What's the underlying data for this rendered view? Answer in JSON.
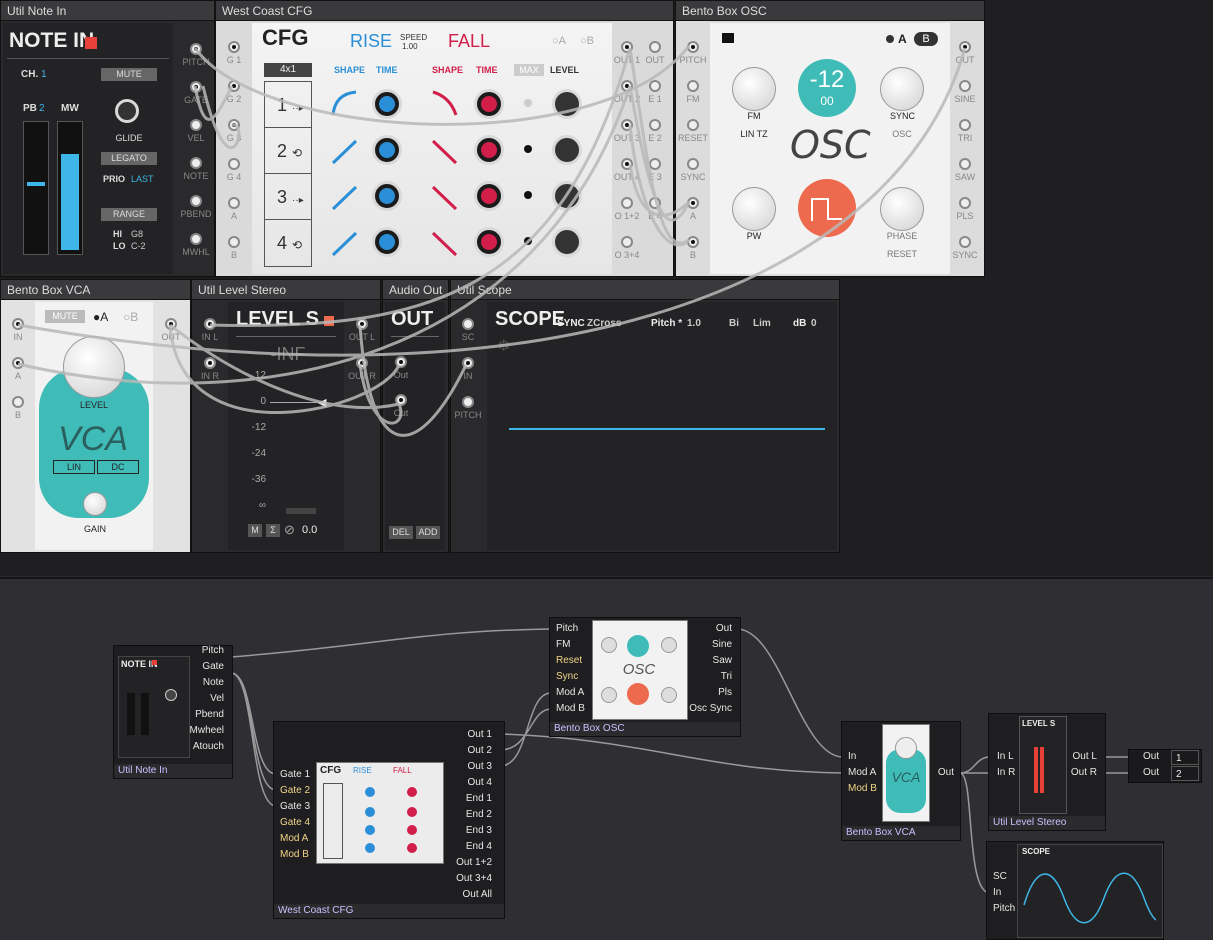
{
  "rack": {
    "note_in": {
      "title": "Util Note In",
      "heading": "NOTE IN",
      "ch_label": "CH.",
      "ch_value": "1",
      "mute": "MUTE",
      "pb_label": "PB",
      "pb_value": "2",
      "mw_label": "MW",
      "glide": "GLIDE",
      "legato": "LEGATO",
      "prio_label": "PRIO",
      "prio_value": "LAST",
      "range": "RANGE",
      "hi_label": "HI",
      "hi_value": "G8",
      "lo_label": "LO",
      "lo_value": "C-2",
      "jacks": [
        "PITCH",
        "GATE",
        "VEL",
        "NOTE",
        "PBEND",
        "MWHL"
      ]
    },
    "cfg": {
      "title": "West Coast CFG",
      "heading": "CFG",
      "rise": "RISE",
      "speed_label": "SPEED",
      "speed_value": "1.00",
      "fall": "FALL",
      "a": "A",
      "b": "B",
      "mode": "4x1",
      "shape": "SHAPE",
      "time": "TIME",
      "shape2": "SHAPE",
      "time2": "TIME",
      "max": "MAX",
      "level": "LEVEL",
      "rows": [
        "1",
        "2",
        "3",
        "4"
      ],
      "in_jacks": [
        "G 1",
        "G 2",
        "G 3",
        "G 4",
        "A",
        "B"
      ],
      "out_left": [
        "OUT 1",
        "OUT 2",
        "OUT 3",
        "OUT 4",
        "O 1+2",
        "O 3+4"
      ],
      "out_right": [
        "OUT",
        "E 1",
        "E 2",
        "E 3",
        "E 4"
      ]
    },
    "osc": {
      "title": "Bento Box OSC",
      "a": "A",
      "b": "B",
      "fm": "FM",
      "lin_tz": "LIN TZ",
      "display_top": "-12",
      "display_bottom": "00",
      "sync": "SYNC",
      "osc_small": "OSC",
      "osc_big": "OSC",
      "pw": "PW",
      "phase": "PHASE",
      "reset": "RESET",
      "in_jacks": [
        "PITCH",
        "FM",
        "RESET",
        "SYNC",
        "A",
        "B"
      ],
      "out_jacks": [
        "OUT",
        "SINE",
        "TRI",
        "SAW",
        "PLS",
        "SYNC"
      ]
    },
    "vca": {
      "title": "Bento Box VCA",
      "mute": "MUTE",
      "a": "A",
      "b": "B",
      "level": "LEVEL",
      "vca": "VCA",
      "lin": "LIN",
      "dc": "DC",
      "gain": "GAIN",
      "in_jacks": [
        "IN",
        "A",
        "B"
      ],
      "out_jack": "OUT"
    },
    "level_stereo": {
      "title": "Util Level Stereo",
      "heading": "LEVEL S",
      "readout": "-INF",
      "scale": [
        "12",
        "0",
        "-12",
        "-24",
        "-36",
        "∞"
      ],
      "m": "M",
      "sigma": "Σ",
      "value": "0.0",
      "in_jacks": [
        "IN L",
        "IN R"
      ],
      "out_jacks": [
        "OUT L",
        "OUT R"
      ]
    },
    "audio_out": {
      "title": "Audio Out",
      "heading": "OUT",
      "jacks": [
        "Out",
        "Out"
      ],
      "del": "DEL",
      "add": "ADD"
    },
    "scope": {
      "title": "Util Scope",
      "heading": "SCOPE",
      "sync_label": "SYNC",
      "sync_value": "ZCross",
      "pitch_label": "Pitch *",
      "pitch_value": "1.0",
      "bi": "Bi",
      "lim": "Lim",
      "db_label": "dB",
      "db_value": "0",
      "jacks": [
        "SC",
        "IN",
        "PITCH"
      ]
    }
  },
  "graph": {
    "note_in": {
      "name": "Util Note In",
      "outputs": [
        "Pitch",
        "Gate",
        "Note",
        "Vel",
        "Pbend",
        "Mwheel",
        "Atouch"
      ]
    },
    "cfg": {
      "name": "West Coast CFG",
      "inputs": [
        "Gate 1",
        "Gate 2",
        "Gate 3",
        "Gate 4",
        "Mod A",
        "Mod B"
      ],
      "outputs": [
        "Out 1",
        "Out 2",
        "Out 3",
        "Out 4",
        "End 1",
        "End 2",
        "End 3",
        "End 4",
        "Out 1+2",
        "Out 3+4",
        "Out All"
      ]
    },
    "osc": {
      "name": "Bento Box OSC",
      "inputs": [
        "Pitch",
        "FM",
        "Reset",
        "Sync",
        "Mod A",
        "Mod B"
      ],
      "outputs": [
        "Out",
        "Sine",
        "Saw",
        "Tri",
        "Pls",
        "Osc Sync"
      ]
    },
    "vca": {
      "name": "Bento Box VCA",
      "inputs": [
        "In",
        "Mod A",
        "Mod B"
      ],
      "output": "Out"
    },
    "level": {
      "name": "Util Level Stereo",
      "inputs": [
        "In L",
        "In R"
      ],
      "outputs": [
        "Out L",
        "Out R"
      ]
    },
    "audio_out": {
      "inputs": [
        "Out",
        "Out"
      ],
      "channels": [
        "1",
        "2"
      ]
    },
    "scope": {
      "inputs": [
        "SC",
        "In",
        "Pitch"
      ]
    }
  },
  "colors": {
    "accent_blue": "#3fb6e8",
    "accent_red": "#d21f4a",
    "teal": "#3fbcb8",
    "orange": "#ee6a4e"
  }
}
